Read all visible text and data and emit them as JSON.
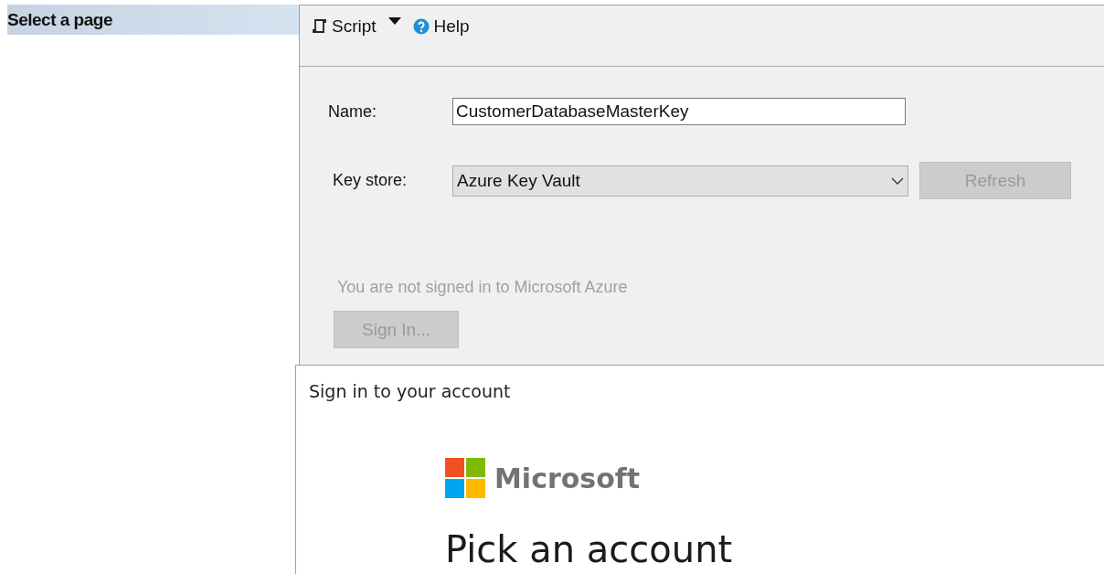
{
  "sidebar": {
    "header": "Select a page"
  },
  "toolbar": {
    "items": [
      {
        "kind": "script",
        "label": "Script"
      },
      {
        "kind": "dropdown"
      },
      {
        "kind": "help",
        "label": "Help"
      }
    ]
  },
  "form": {
    "name_label": "Name:",
    "name_value": "CustomerDatabaseMasterKey",
    "key_store_label": "Key store:",
    "key_store_value": "Azure Key Vault",
    "refresh": {
      "label": "Refresh",
      "disabled": true
    },
    "status": "You are not signed in to Microsoft Azure",
    "sign_in": {
      "label": "Sign In...",
      "disabled": true
    }
  },
  "dialog": {
    "title": "Sign in to your account",
    "brand": "Microsoft",
    "heading": "Pick an account"
  }
}
